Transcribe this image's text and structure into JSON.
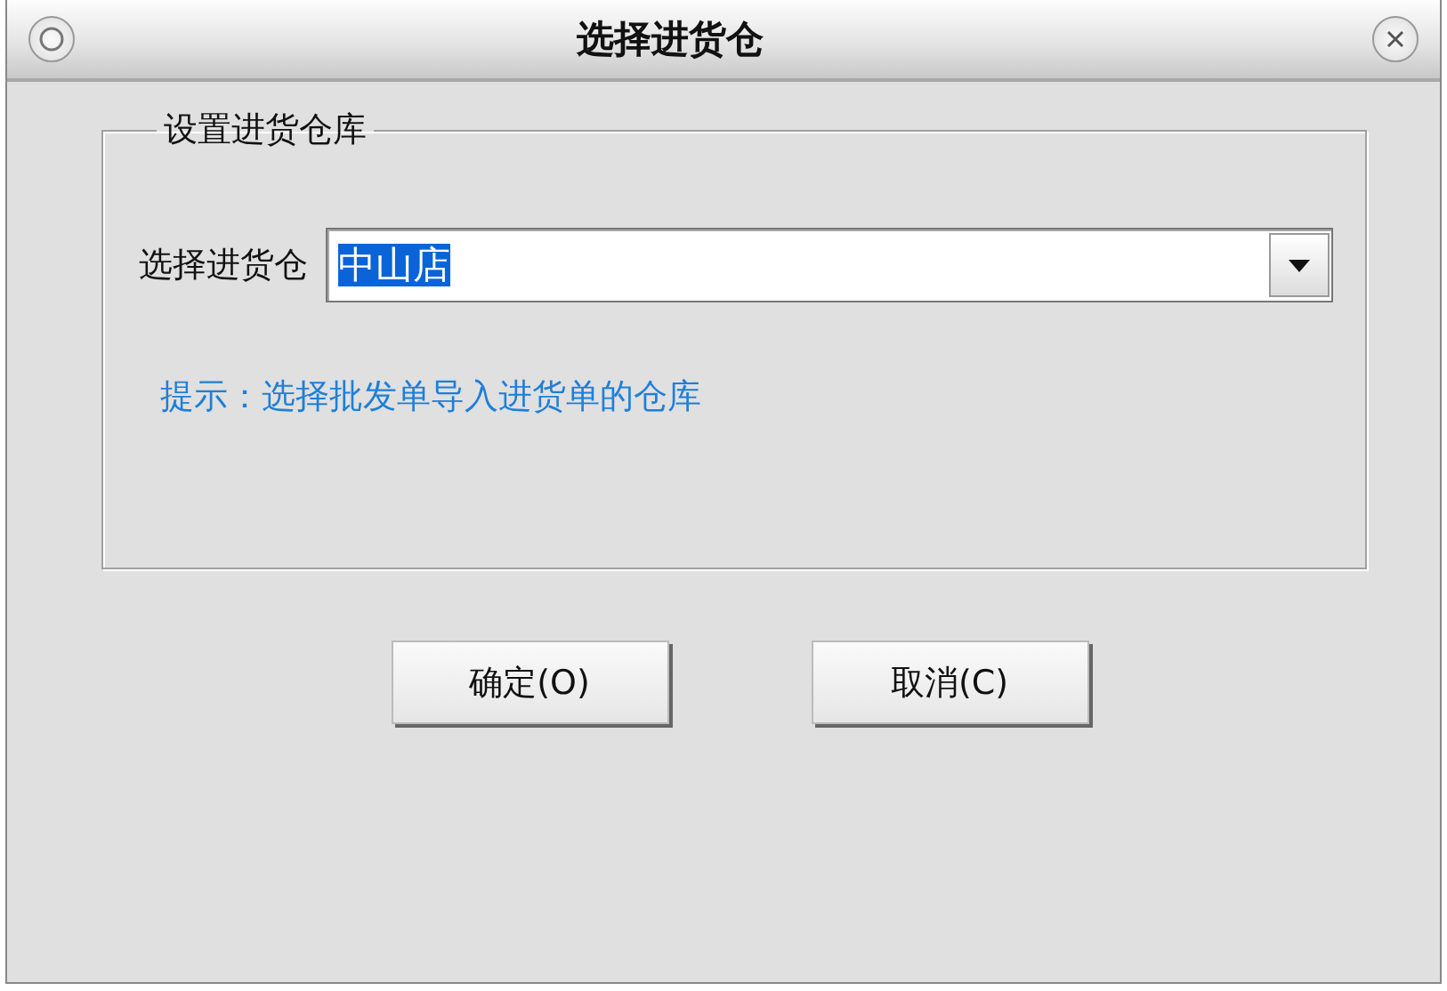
{
  "window": {
    "title": "选择进货仓"
  },
  "group": {
    "title": "设置进货仓库",
    "warehouse": {
      "label": "选择进货仓",
      "value": "中山店",
      "text_selected": true
    },
    "hint": "提示：选择批发单导入进货单的仓库"
  },
  "buttons": [
    "确定(O)",
    "取消(C)"
  ]
}
